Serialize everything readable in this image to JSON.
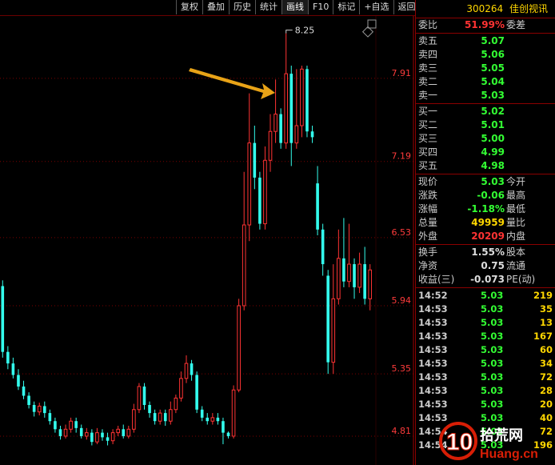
{
  "toolbar": {
    "buttons": [
      "复权",
      "叠加",
      "历史",
      "统计",
      "画线",
      "F10",
      "标记",
      "+自选",
      "返回"
    ],
    "active_index": 4
  },
  "stock": {
    "code": "300264",
    "name": "佳创视讯"
  },
  "chart": {
    "price_labels": [
      "7.91",
      "7.19",
      "6.53",
      "5.94",
      "5.35",
      "4.81"
    ],
    "high_annotation": "8.25"
  },
  "chart_data": {
    "type": "candlestick",
    "y_axis_ticks": [
      7.91,
      7.19,
      6.53,
      5.94,
      5.35,
      4.81
    ],
    "ylim": [
      4.56,
      8.45
    ],
    "candles": [
      {
        "o": 6.11,
        "c": 5.54,
        "h": 6.16,
        "l": 5.49
      },
      {
        "o": 5.54,
        "c": 5.44,
        "h": 5.59,
        "l": 5.39
      },
      {
        "o": 5.44,
        "c": 5.34,
        "h": 5.49,
        "l": 5.31
      },
      {
        "o": 5.34,
        "c": 5.24,
        "h": 5.39,
        "l": 5.21
      },
      {
        "o": 5.24,
        "c": 5.16,
        "h": 5.29,
        "l": 5.13
      },
      {
        "o": 5.16,
        "c": 5.08,
        "h": 5.19,
        "l": 5.05
      },
      {
        "o": 5.08,
        "c": 5.02,
        "h": 5.11,
        "l": 4.98
      },
      {
        "o": 5.02,
        "c": 5.07,
        "h": 5.1,
        "l": 4.99
      },
      {
        "o": 5.07,
        "c": 5.01,
        "h": 5.11,
        "l": 4.97
      },
      {
        "o": 5.01,
        "c": 4.94,
        "h": 5.04,
        "l": 4.91
      },
      {
        "o": 4.94,
        "c": 4.87,
        "h": 4.97,
        "l": 4.84
      },
      {
        "o": 4.87,
        "c": 4.81,
        "h": 4.9,
        "l": 4.78
      },
      {
        "o": 4.81,
        "c": 4.87,
        "h": 4.91,
        "l": 4.79
      },
      {
        "o": 4.87,
        "c": 4.94,
        "h": 4.97,
        "l": 4.84
      },
      {
        "o": 4.94,
        "c": 4.88,
        "h": 4.97,
        "l": 4.84
      },
      {
        "o": 4.88,
        "c": 4.81,
        "h": 4.91,
        "l": 4.79
      },
      {
        "o": 4.81,
        "c": 4.84,
        "h": 4.88,
        "l": 4.78
      },
      {
        "o": 4.84,
        "c": 4.76,
        "h": 4.87,
        "l": 4.73
      },
      {
        "o": 4.76,
        "c": 4.84,
        "h": 4.88,
        "l": 4.74
      },
      {
        "o": 4.84,
        "c": 4.8,
        "h": 4.87,
        "l": 4.77
      },
      {
        "o": 4.8,
        "c": 4.77,
        "h": 4.84,
        "l": 4.73
      },
      {
        "o": 4.77,
        "c": 4.84,
        "h": 4.87,
        "l": 4.74
      },
      {
        "o": 4.84,
        "c": 4.87,
        "h": 4.9,
        "l": 4.81
      },
      {
        "o": 4.87,
        "c": 4.81,
        "h": 4.91,
        "l": 4.79
      },
      {
        "o": 4.81,
        "c": 4.87,
        "h": 4.9,
        "l": 4.79
      },
      {
        "o": 4.87,
        "c": 5.04,
        "h": 5.09,
        "l": 4.84
      },
      {
        "o": 5.04,
        "c": 5.24,
        "h": 5.27,
        "l": 5.01
      },
      {
        "o": 5.24,
        "c": 5.08,
        "h": 5.27,
        "l": 5.04
      },
      {
        "o": 5.08,
        "c": 5.01,
        "h": 5.11,
        "l": 4.97
      },
      {
        "o": 5.01,
        "c": 4.94,
        "h": 5.04,
        "l": 4.91
      },
      {
        "o": 4.94,
        "c": 5.01,
        "h": 5.04,
        "l": 4.91
      },
      {
        "o": 5.01,
        "c": 4.94,
        "h": 5.04,
        "l": 4.9
      },
      {
        "o": 4.94,
        "c": 5.04,
        "h": 5.11,
        "l": 4.91
      },
      {
        "o": 5.04,
        "c": 5.14,
        "h": 5.17,
        "l": 5.01
      },
      {
        "o": 5.14,
        "c": 5.31,
        "h": 5.37,
        "l": 5.11
      },
      {
        "o": 5.31,
        "c": 5.44,
        "h": 5.51,
        "l": 5.27
      },
      {
        "o": 5.44,
        "c": 5.34,
        "h": 5.47,
        "l": 5.29
      },
      {
        "o": 5.34,
        "c": 5.04,
        "h": 5.37,
        "l": 5.01
      },
      {
        "o": 5.04,
        "c": 4.97,
        "h": 5.07,
        "l": 4.94
      },
      {
        "o": 4.97,
        "c": 4.94,
        "h": 5.01,
        "l": 4.91
      },
      {
        "o": 4.94,
        "c": 4.97,
        "h": 5.01,
        "l": 4.91
      },
      {
        "o": 4.97,
        "c": 4.94,
        "h": 5.01,
        "l": 4.91
      },
      {
        "o": 4.94,
        "c": 4.84,
        "h": 4.97,
        "l": 4.74
      },
      {
        "o": 4.84,
        "c": 4.81,
        "h": 4.85,
        "l": 4.79
      },
      {
        "o": 4.81,
        "c": 5.21,
        "h": 5.25,
        "l": 4.79
      },
      {
        "o": 5.21,
        "c": 5.94,
        "h": 6.0,
        "l": 5.19
      },
      {
        "o": 5.94,
        "c": 6.64,
        "h": 7.1,
        "l": 5.9
      },
      {
        "o": 6.64,
        "c": 7.35,
        "h": 7.78,
        "l": 6.5
      },
      {
        "o": 7.35,
        "c": 7.05,
        "h": 7.5,
        "l": 6.95
      },
      {
        "o": 7.05,
        "c": 6.65,
        "h": 7.1,
        "l": 6.6
      },
      {
        "o": 6.65,
        "c": 7.2,
        "h": 7.32,
        "l": 6.6
      },
      {
        "o": 7.2,
        "c": 7.45,
        "h": 7.6,
        "l": 7.1
      },
      {
        "o": 7.45,
        "c": 7.6,
        "h": 7.9,
        "l": 7.35
      },
      {
        "o": 7.6,
        "c": 7.35,
        "h": 7.65,
        "l": 7.3
      },
      {
        "o": 7.35,
        "c": 7.95,
        "h": 8.3,
        "l": 7.3
      },
      {
        "o": 7.95,
        "c": 7.35,
        "h": 8.02,
        "l": 7.15
      },
      {
        "o": 7.35,
        "c": 7.5,
        "h": 7.99,
        "l": 7.3
      },
      {
        "o": 7.5,
        "c": 7.99,
        "h": 8.02,
        "l": 7.4
      },
      {
        "o": 7.99,
        "c": 7.45,
        "h": 8.02,
        "l": 7.4
      },
      {
        "o": 7.45,
        "c": 7.4,
        "h": 7.5,
        "l": 7.35
      },
      {
        "o": 7.0,
        "c": 6.6,
        "h": 7.15,
        "l": 6.55
      },
      {
        "o": 6.6,
        "c": 6.3,
        "h": 6.65,
        "l": 6.2
      },
      {
        "o": 6.2,
        "c": 5.45,
        "h": 6.25,
        "l": 5.35
      },
      {
        "o": 5.45,
        "c": 6.0,
        "h": 6.3,
        "l": 5.35
      },
      {
        "o": 6.0,
        "c": 6.35,
        "h": 6.6,
        "l": 5.95
      },
      {
        "o": 6.35,
        "c": 6.15,
        "h": 6.7,
        "l": 6.1
      },
      {
        "o": 6.15,
        "c": 6.3,
        "h": 6.65,
        "l": 6.1
      },
      {
        "o": 6.3,
        "c": 6.1,
        "h": 6.35,
        "l": 6.0
      },
      {
        "o": 6.1,
        "c": 6.3,
        "h": 6.4,
        "l": 6.05
      },
      {
        "o": 6.3,
        "c": 6.0,
        "h": 6.45,
        "l": 5.95
      },
      {
        "o": 6.0,
        "c": 6.25,
        "h": 6.3,
        "l": 5.9
      }
    ]
  },
  "quote": {
    "wb_label": "委比",
    "wb_value": "51.99%",
    "wb_label2": "委差",
    "asks": [
      {
        "label": "卖五",
        "price": "5.07"
      },
      {
        "label": "卖四",
        "price": "5.06"
      },
      {
        "label": "卖三",
        "price": "5.05"
      },
      {
        "label": "卖二",
        "price": "5.04"
      },
      {
        "label": "卖一",
        "price": "5.03"
      }
    ],
    "bids": [
      {
        "label": "买一",
        "price": "5.02"
      },
      {
        "label": "买二",
        "price": "5.01"
      },
      {
        "label": "买三",
        "price": "5.00"
      },
      {
        "label": "买四",
        "price": "4.99"
      },
      {
        "label": "买五",
        "price": "4.98"
      }
    ],
    "stats1": [
      {
        "label": "现价",
        "value": "5.03",
        "label2": "今开",
        "color": "green"
      },
      {
        "label": "涨跌",
        "value": "-0.06",
        "label2": "最高",
        "color": "green"
      },
      {
        "label": "涨幅",
        "value": "-1.18%",
        "label2": "最低",
        "color": "green"
      },
      {
        "label": "总量",
        "value": "49959",
        "label2": "量比",
        "color": "yellow"
      },
      {
        "label": "外盘",
        "value": "20209",
        "label2": "内盘",
        "color": "red"
      }
    ],
    "stats2": [
      {
        "label": "换手",
        "value": "1.55%",
        "label2": "股本"
      },
      {
        "label": "净资",
        "value": "0.75",
        "label2": "流通"
      },
      {
        "label": "收益(三)",
        "value": "-0.073",
        "label2": "PE(动)"
      }
    ],
    "ticks": [
      {
        "time": "14:52",
        "price": "5.03",
        "vol": "219"
      },
      {
        "time": "14:53",
        "price": "5.03",
        "vol": "35"
      },
      {
        "time": "14:53",
        "price": "5.03",
        "vol": "13"
      },
      {
        "time": "14:53",
        "price": "5.03",
        "vol": "167"
      },
      {
        "time": "14:53",
        "price": "5.03",
        "vol": "60"
      },
      {
        "time": "14:53",
        "price": "5.03",
        "vol": "34"
      },
      {
        "time": "14:53",
        "price": "5.03",
        "vol": "72"
      },
      {
        "time": "14:53",
        "price": "5.03",
        "vol": "28"
      },
      {
        "time": "14:53",
        "price": "5.03",
        "vol": "20"
      },
      {
        "time": "14:53",
        "price": "5.03",
        "vol": "40"
      },
      {
        "time": "14:54",
        "price": "5.03",
        "vol": "72"
      },
      {
        "time": "14:54",
        "price": "5.03",
        "vol": "196"
      }
    ]
  },
  "watermark": {
    "text1": "拾荒网",
    "text2": "Huang.cn",
    "logo": "10"
  },
  "colors": {
    "up": "#ff3333",
    "down": "#33ffee",
    "grid": "#7a0000",
    "axis": "#9e0000"
  }
}
